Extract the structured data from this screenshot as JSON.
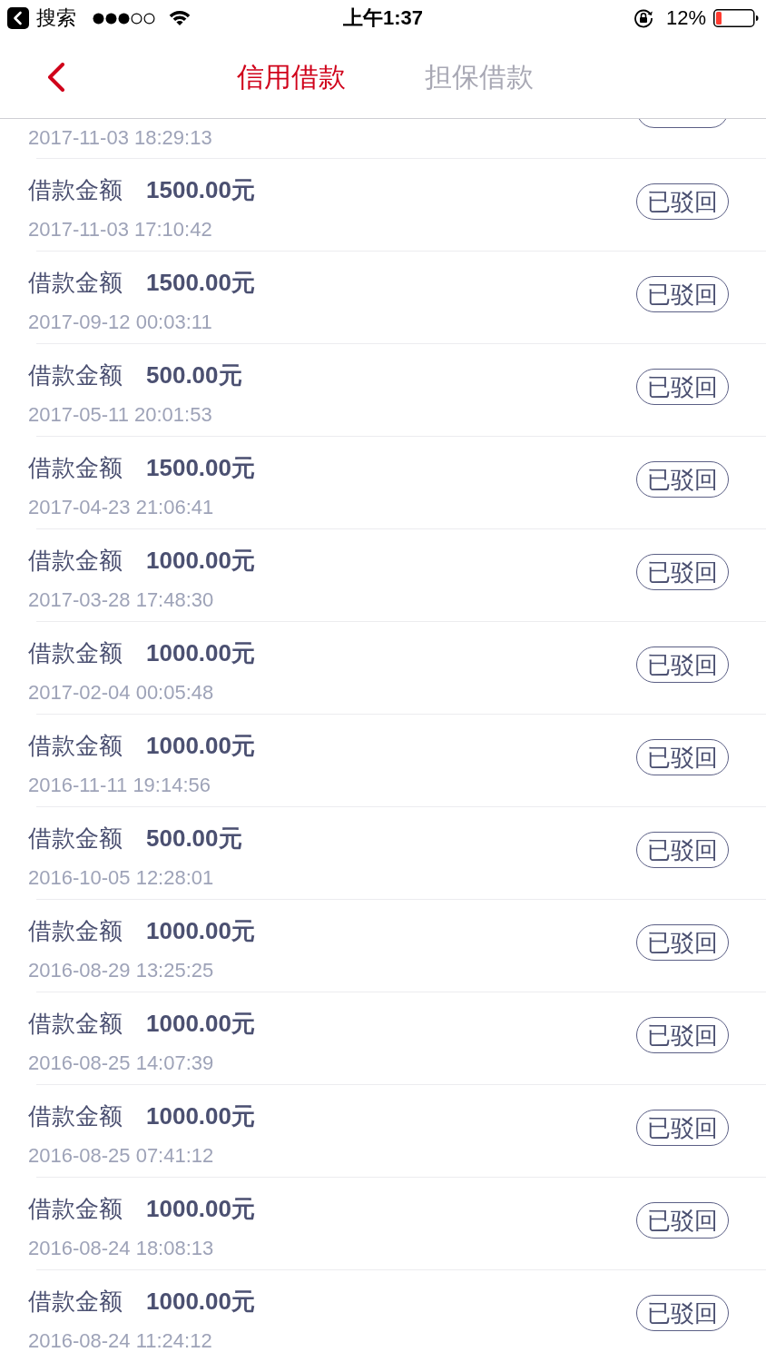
{
  "status_bar": {
    "back_label": "搜索",
    "time": "上午1:37",
    "battery": "12%"
  },
  "nav": {
    "tabs": [
      {
        "label": "信用借款",
        "selected": true
      },
      {
        "label": "担保借款",
        "selected": false
      }
    ]
  },
  "partial_record": {
    "date": "2017-11-03 18:29:13"
  },
  "records": [
    {
      "label": "借款金额",
      "amount": "1500.00元",
      "date": "2017-11-03 17:10:42",
      "status": "已驳回"
    },
    {
      "label": "借款金额",
      "amount": "1500.00元",
      "date": "2017-09-12 00:03:11",
      "status": "已驳回"
    },
    {
      "label": "借款金额",
      "amount": "500.00元",
      "date": "2017-05-11 20:01:53",
      "status": "已驳回"
    },
    {
      "label": "借款金额",
      "amount": "1500.00元",
      "date": "2017-04-23 21:06:41",
      "status": "已驳回"
    },
    {
      "label": "借款金额",
      "amount": "1000.00元",
      "date": "2017-03-28 17:48:30",
      "status": "已驳回"
    },
    {
      "label": "借款金额",
      "amount": "1000.00元",
      "date": "2017-02-04 00:05:48",
      "status": "已驳回"
    },
    {
      "label": "借款金额",
      "amount": "1000.00元",
      "date": "2016-11-11 19:14:56",
      "status": "已驳回"
    },
    {
      "label": "借款金额",
      "amount": "500.00元",
      "date": "2016-10-05 12:28:01",
      "status": "已驳回"
    },
    {
      "label": "借款金额",
      "amount": "1000.00元",
      "date": "2016-08-29 13:25:25",
      "status": "已驳回"
    },
    {
      "label": "借款金额",
      "amount": "1000.00元",
      "date": "2016-08-25 14:07:39",
      "status": "已驳回"
    },
    {
      "label": "借款金额",
      "amount": "1000.00元",
      "date": "2016-08-25 07:41:12",
      "status": "已驳回"
    },
    {
      "label": "借款金额",
      "amount": "1000.00元",
      "date": "2016-08-24 18:08:13",
      "status": "已驳回"
    },
    {
      "label": "借款金额",
      "amount": "1000.00元",
      "date": "2016-08-24 11:24:12",
      "status": "已驳回"
    }
  ]
}
